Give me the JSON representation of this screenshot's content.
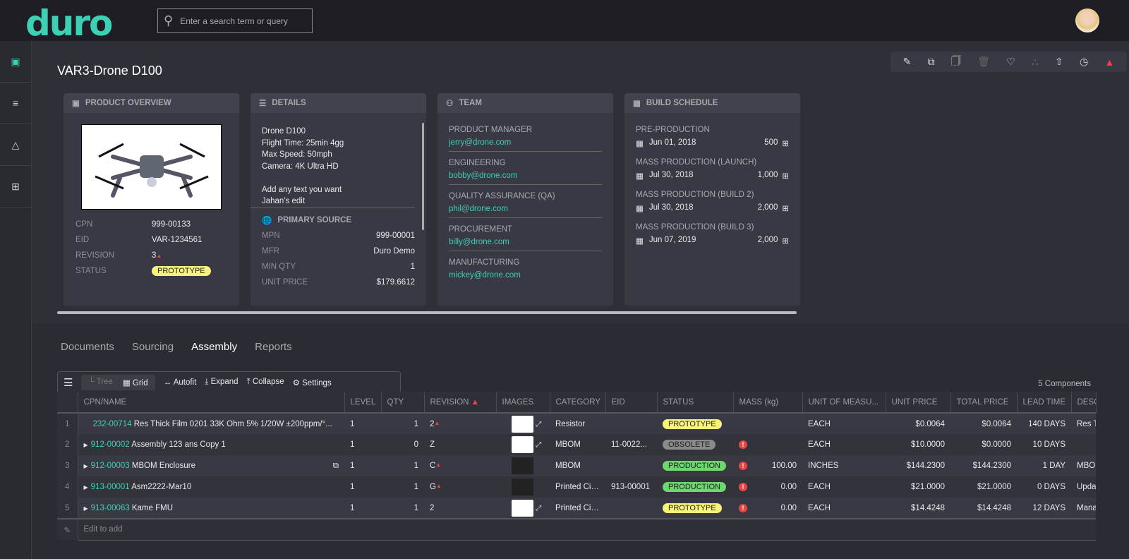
{
  "app": {
    "logo": "duro",
    "search_placeholder": "Enter a search term or query"
  },
  "page": {
    "title": "VAR3-Drone D100"
  },
  "overview": {
    "header": "PRODUCT OVERVIEW",
    "fields": [
      {
        "k": "CPN",
        "v": "999-00133"
      },
      {
        "k": "EID",
        "v": "VAR-1234561"
      },
      {
        "k": "REVISION",
        "v": "3"
      },
      {
        "k": "STATUS",
        "v": "PROTOTYPE"
      }
    ]
  },
  "details": {
    "header": "DETAILS",
    "lines": [
      "Drone D100",
      "Flight Time: 25min 4gg",
      "Max Speed: 50mph",
      "Camera: 4K Ultra HD",
      "",
      "Add any text you want",
      "Jahan's edit"
    ],
    "source_header": "PRIMARY SOURCE",
    "fields": [
      {
        "k": "MPN",
        "v": "999-00001"
      },
      {
        "k": "MFR",
        "v": "Duro Demo"
      },
      {
        "k": "MIN QTY",
        "v": "1"
      },
      {
        "k": "UNIT PRICE",
        "v": "$179.6612"
      }
    ]
  },
  "team": {
    "header": "TEAM",
    "members": [
      {
        "role": "PRODUCT MANAGER",
        "email": "jerry@drone.com"
      },
      {
        "role": "ENGINEERING",
        "email": "bobby@drone.com"
      },
      {
        "role": "QUALITY ASSURANCE (QA)",
        "email": "phil@drone.com"
      },
      {
        "role": "PROCUREMENT",
        "email": "billy@drone.com"
      },
      {
        "role": "MANUFACTURING",
        "email": "mickey@drone.com"
      }
    ]
  },
  "schedule": {
    "header": "BUILD SCHEDULE",
    "items": [
      {
        "name": "PRE-PRODUCTION",
        "date": "Jun 01, 2018",
        "qty": "500"
      },
      {
        "name": "MASS PRODUCTION (LAUNCH)",
        "date": "Jul 30, 2018",
        "qty": "1,000"
      },
      {
        "name": "MASS PRODUCTION (BUILD 2)",
        "date": "Jul 30, 2018",
        "qty": "2,000"
      },
      {
        "name": "MASS PRODUCTION (BUILD 3)",
        "date": "Jun 07, 2019",
        "qty": "2,000"
      }
    ]
  },
  "tabs": [
    "Documents",
    "Sourcing",
    "Assembly",
    "Reports"
  ],
  "toolbar": {
    "tree": "Tree",
    "grid": "Grid",
    "autofit": "Autofit",
    "expand": "Expand",
    "collapse": "Collapse",
    "settings": "Settings",
    "count": "5 Components"
  },
  "columns": [
    "CPN/NAME",
    "LEVEL",
    "QTY",
    "REVISION",
    "IMAGES",
    "CATEGORY",
    "EID",
    "STATUS",
    "MASS (kg)",
    "UNIT OF MEASU...",
    "UNIT PRICE",
    "TOTAL PRICE",
    "LEAD TIME",
    "DESC"
  ],
  "rows": [
    {
      "n": "1",
      "cpn": "232-00714",
      "name": "Res Thick Film 0201 33K Ohm 5% 1/20W ±200ppm/°...",
      "level": "1",
      "qty": "1",
      "rev": "2",
      "revMod": true,
      "cat": "Resistor",
      "eid": "",
      "status": "PROTOTYPE",
      "warn": false,
      "mass": "",
      "uom": "EACH",
      "unit": "$0.0064",
      "total": "$0.0064",
      "lead": "140 DAYS",
      "desc": "Res T",
      "img": "light"
    },
    {
      "n": "2",
      "cpn": "912-00002",
      "name": "Assembly 123 ans Copy 1",
      "level": "1",
      "qty": "0",
      "rev": "Z",
      "revMod": false,
      "cat": "MBOM",
      "eid": "11-0022...",
      "status": "OBSOLETE",
      "warn": true,
      "mass": "",
      "uom": "EACH",
      "unit": "$10.0000",
      "total": "$0.0000",
      "lead": "10 DAYS",
      "desc": "",
      "img": "light"
    },
    {
      "n": "3",
      "cpn": "912-00003",
      "name": "MBOM Enclosure",
      "level": "1",
      "qty": "1",
      "rev": "C",
      "revMod": true,
      "cat": "MBOM",
      "eid": "",
      "status": "PRODUCTION",
      "warn": true,
      "mass": "100.00",
      "uom": "INCHES",
      "unit": "$144.2300",
      "total": "$144.2300",
      "lead": "1 DAY",
      "desc": "MBO",
      "img": "dark"
    },
    {
      "n": "4",
      "cpn": "913-00001",
      "name": "Asm2222-Mar10",
      "level": "1",
      "qty": "1",
      "rev": "G",
      "revMod": true,
      "cat": "Printed Cir...",
      "eid": "913-00001",
      "status": "PRODUCTION",
      "warn": true,
      "mass": "0.00",
      "uom": "EACH",
      "unit": "$21.0000",
      "total": "$21.0000",
      "lead": "0 DAYS",
      "desc": "Upda",
      "img": "dark"
    },
    {
      "n": "5",
      "cpn": "913-00063",
      "name": "Kame FMU",
      "level": "1",
      "qty": "1",
      "rev": "2",
      "revMod": false,
      "cat": "Printed Cir...",
      "eid": "",
      "status": "PROTOTYPE",
      "warn": true,
      "mass": "0.00",
      "uom": "EACH",
      "unit": "$14.4248",
      "total": "$14.4248",
      "lead": "12 DAYS",
      "desc": "Mana",
      "img": "light"
    }
  ],
  "edit_placeholder": "Edit to add",
  "colors": {
    "accent": "#3cd1b5",
    "prototype": "#f8f47a",
    "production": "#6bd86b",
    "obsolete": "#8a8a8a",
    "alert": "#e84545"
  }
}
